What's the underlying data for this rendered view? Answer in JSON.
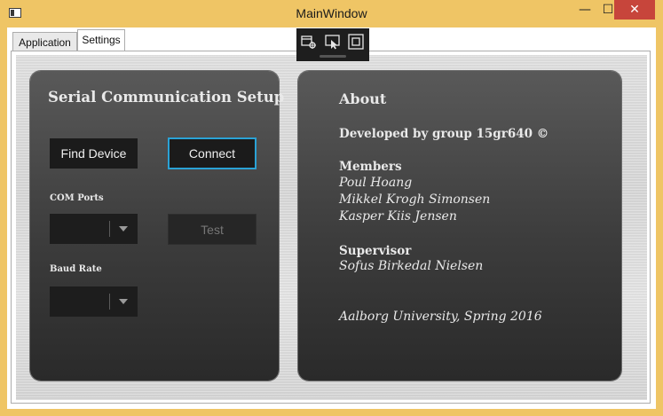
{
  "window": {
    "title": "MainWindow",
    "minimize_glyph": "—",
    "maximize_glyph": "☐",
    "close_glyph": "✕"
  },
  "tabs": [
    {
      "label": "Application",
      "selected": false
    },
    {
      "label": "Settings",
      "selected": true
    }
  ],
  "debug_toolbar": {
    "icons": [
      "select-element-icon",
      "pointer-select-icon",
      "layout-adorner-icon"
    ]
  },
  "setup": {
    "title": "Serial Communication Setup",
    "find_device_label": "Find Device",
    "connect_label": "Connect",
    "com_ports_label": "COM Ports",
    "com_ports_value": "",
    "test_label": "Test",
    "baud_rate_label": "Baud Rate",
    "baud_rate_value": ""
  },
  "about": {
    "title": "About",
    "developed_by": "Developed by group 15gr640 ©",
    "members_heading": "Members",
    "members": [
      "Poul Hoang",
      "Mikkel Krogh Simonsen",
      "Kasper Kiis Jensen"
    ],
    "supervisor_heading": "Supervisor",
    "supervisor": "Sofus Birkedal Nielsen",
    "footer": "Aalborg University, Spring 2016"
  },
  "colors": {
    "window_frame": "#efc565",
    "close_button": "#c7453b",
    "connect_focus_border": "#2aa2d6",
    "panel_dark": "#3c3c3c"
  }
}
